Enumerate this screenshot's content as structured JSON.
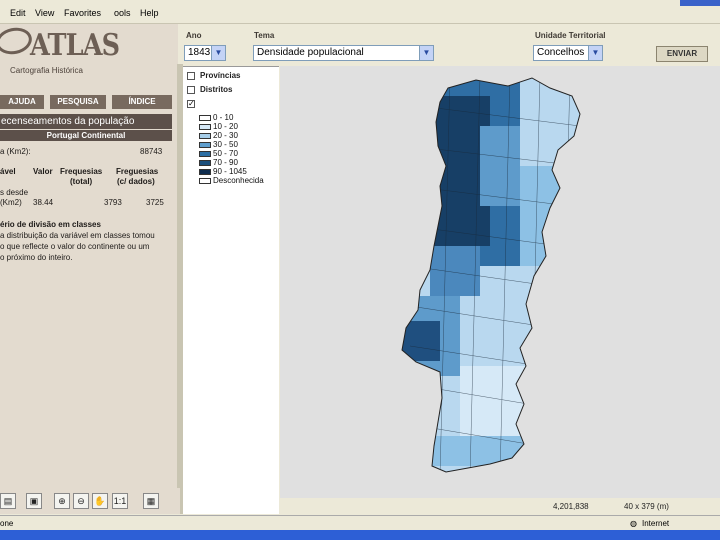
{
  "menu": [
    "Edit",
    "View",
    "Favorites",
    "ools",
    "Help"
  ],
  "logo": {
    "name": "ATLAS",
    "subtitle": "Cartografia Histórica"
  },
  "nav": {
    "ajuda": "AJUDA",
    "pesquisa": "PESQUISA",
    "indice": "ÍNDICE"
  },
  "left": {
    "banner": "ecenseamentos da população",
    "subbanner": "Portugal Continental",
    "area_label": "a (Km2):",
    "area_value": "88743",
    "headers": {
      "var": "ável",
      "valor": "Valor",
      "freq_total": "Frequesias",
      "freq_total2": "(total)",
      "freq_dados": "Freguesias",
      "freq_dados2": "(c/ dados)"
    },
    "row_label1": "s desde",
    "row_label2": "(Km2)",
    "row_values": {
      "valor": "38.44",
      "total": "3793",
      "dados": "3725"
    },
    "criterio_title": "ério de divisão em classes",
    "criterio_l1": "a distribuição da variável em classes tomou",
    "criterio_l2": "o que reflecte o valor do continente ou um",
    "criterio_l3": "o próximo do inteiro."
  },
  "toolbar": {
    "ano_label": "Ano",
    "ano_value": "1843",
    "tema_label": "Tema",
    "tema_value": "Densidade populacional",
    "unidade_label": "Unidade Territorial",
    "unidade_value": "Concelhos",
    "enviar": "ENVIAR"
  },
  "layers": {
    "provincias": "Províncias",
    "distritos": "Distritos",
    "legend": [
      {
        "label": "0 - 10",
        "color": "#ffffff"
      },
      {
        "label": "10 - 20",
        "color": "#d6e9f7"
      },
      {
        "label": "20 - 30",
        "color": "#a6cde8"
      },
      {
        "label": "30 - 50",
        "color": "#5f9fcf"
      },
      {
        "label": "50 - 70",
        "color": "#2c6fa5"
      },
      {
        "label": "70 - 90",
        "color": "#1b4f7c"
      },
      {
        "label": "90 - 1045",
        "color": "#0f2d4f"
      },
      {
        "label": "Desconhecida",
        "color": "#ffffff"
      }
    ]
  },
  "tools": {
    "scale": "1:1"
  },
  "coords": {
    "x": "4,201,838",
    "size": "40 x 379 (m)"
  },
  "status": {
    "left": "one",
    "zone": "Internet"
  }
}
